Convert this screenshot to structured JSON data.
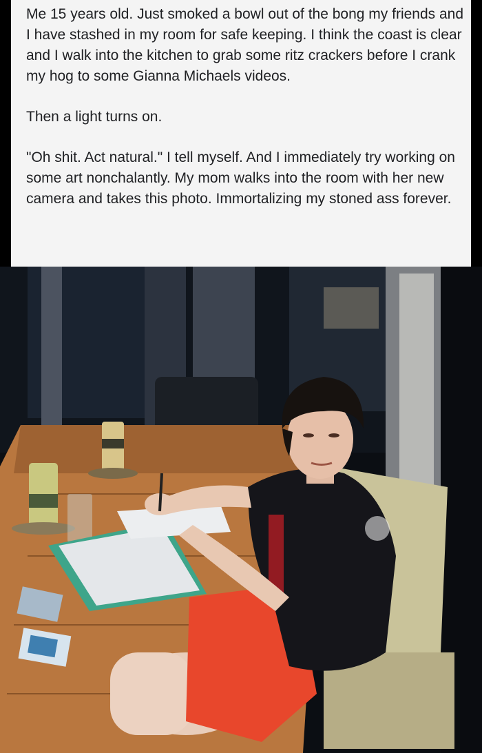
{
  "post": {
    "paragraphs": [
      "Me 15 years old. Just smoked a bowl out of the bong my friends and I have stashed in my room for safe keeping. I think the coast is clear and I walk into the kitchen to grab some ritz crackers before I crank my hog to some Gianna Michaels videos.",
      "Then a light turns on.",
      "\"Oh shit. Act natural.\" I tell myself. And I immediately try working on some art nonchalantly. My mom walks into the room with her new camera and takes this photo. Immortalizing my stoned ass forever."
    ]
  },
  "photo": {
    "colors": {
      "table": "#b9773f",
      "shirt": "#15151a",
      "shorts": "#e8472c",
      "chair": "#c9c39a",
      "background": "#0c0f14"
    }
  }
}
